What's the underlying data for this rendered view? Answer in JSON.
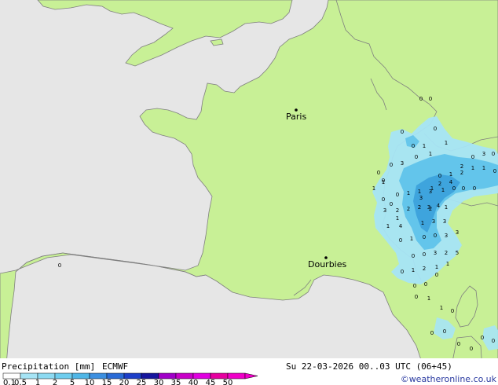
{
  "colors": {
    "sea": "#e6e6e6",
    "land": "#c8f096",
    "border": "#7f7f7f",
    "precip_light": "#a6e4f5",
    "precip_mid": "#5fc3ea",
    "precip_heavy": "#3aa0dc"
  },
  "cities": [
    {
      "name": "Paris"
    },
    {
      "name": "Dourbies"
    }
  ],
  "map_values": [
    "0",
    "0",
    "0",
    "0",
    "1",
    "0",
    "0",
    "1",
    "0",
    "3",
    "0",
    "1",
    "0",
    "1",
    "2",
    "0",
    "3",
    "0",
    "0",
    "1",
    "1",
    "2",
    "4",
    "2",
    "3",
    "1",
    "1",
    "0",
    "1",
    "0",
    "0",
    "0",
    "1",
    "1",
    "3",
    "2",
    "2",
    "2",
    "2",
    "3",
    "1",
    "3",
    "3",
    "3",
    "4",
    "1",
    "0",
    "1",
    "0",
    "0",
    "3",
    "3",
    "5",
    "2",
    "3",
    "0",
    "0",
    "0",
    "1",
    "2",
    "1",
    "1",
    "0",
    "0",
    "0",
    "1",
    "4",
    "0",
    "0",
    "1",
    "0",
    "1",
    "0",
    "1",
    "1",
    "0",
    "0",
    "0",
    "0",
    "0",
    "0",
    "0",
    "0"
  ],
  "legend": {
    "title": "Precipitation [mm]",
    "model": "ECMWF",
    "ticks": [
      "0.1",
      "0.5",
      "1",
      "2",
      "5",
      "10",
      "15",
      "20",
      "25",
      "30",
      "35",
      "40",
      "45",
      "50"
    ],
    "colors": [
      "#ffffff",
      "#a6e4f5",
      "#8cdaf2",
      "#6ecdee",
      "#4fb6e6",
      "#3c8fe0",
      "#2a6bd6",
      "#1d3fc8",
      "#16169e",
      "#a000c8",
      "#c800c8",
      "#e000e0",
      "#e600a0",
      "#f000c8"
    ]
  },
  "footer": {
    "datetime": "Su 22-03-2026 00..03 UTC (06+45)",
    "credit": "©weatheronline.co.uk"
  }
}
